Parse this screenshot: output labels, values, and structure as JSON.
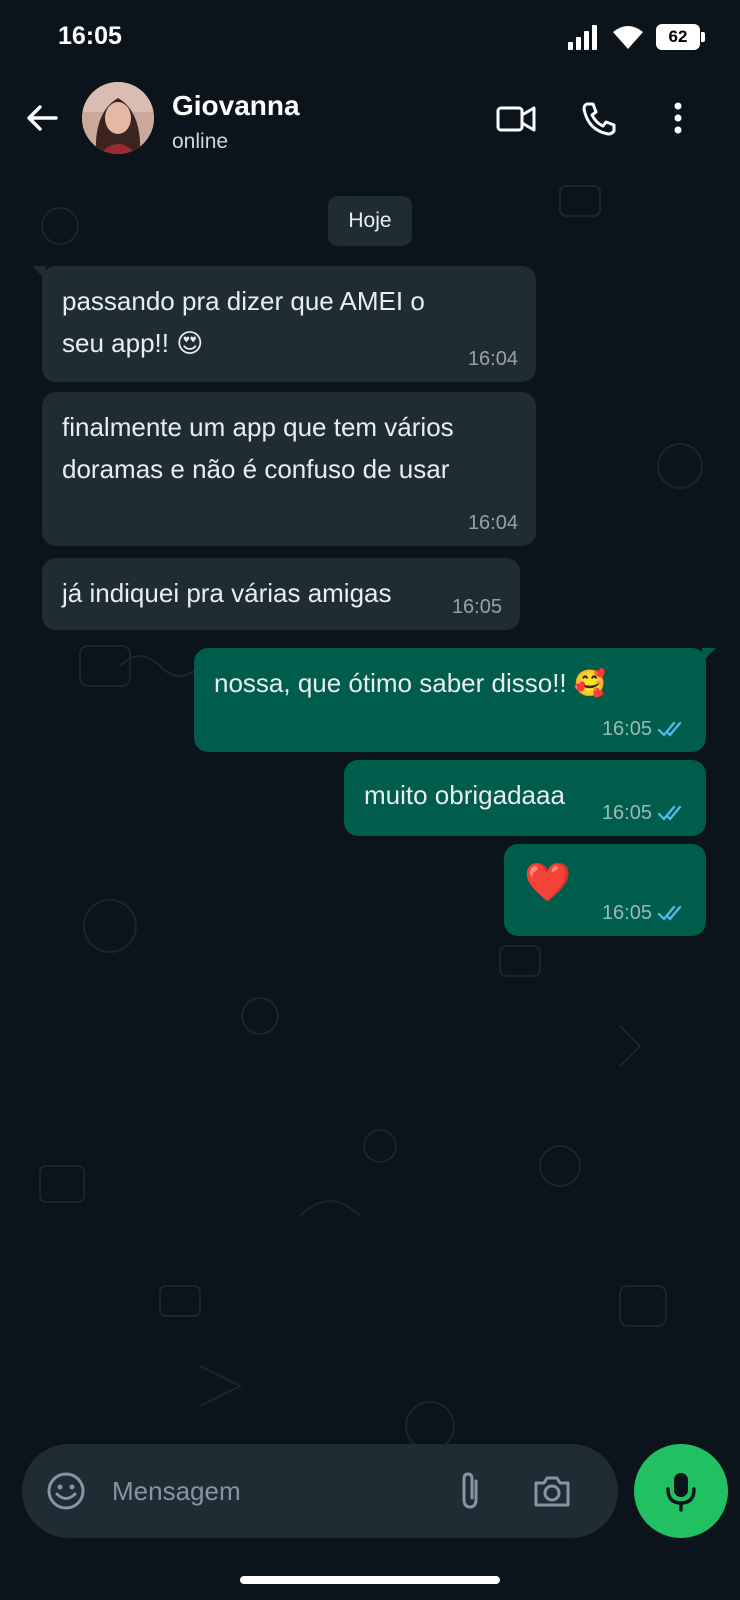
{
  "status_bar": {
    "time": "16:05",
    "battery": "62"
  },
  "header": {
    "contact_name": "Giovanna",
    "contact_status": "online"
  },
  "chat": {
    "date_divider": "Hoje",
    "messages": [
      {
        "direction": "in",
        "text": "passando pra dizer que AMEI o seu app!! 😍",
        "time": "16:04"
      },
      {
        "direction": "in",
        "text": "finalmente um app que tem vários doramas e não é confuso de usar",
        "time": "16:04"
      },
      {
        "direction": "in",
        "text": "já indiquei pra várias amigas",
        "time": "16:05"
      },
      {
        "direction": "out",
        "text": "nossa, que ótimo saber disso!! 🥰",
        "time": "16:05",
        "status": "read"
      },
      {
        "direction": "out",
        "text": "muito obrigadaaa",
        "time": "16:05",
        "status": "read"
      },
      {
        "direction": "out",
        "text": "❤️",
        "time": "16:05",
        "status": "read"
      }
    ]
  },
  "composer": {
    "placeholder": "Mensagem"
  },
  "colors": {
    "background": "#0b141a",
    "incoming_bubble": "#1f2c34",
    "outgoing_bubble": "#005c4b",
    "read_ticks": "#53bdeb",
    "mic_button": "#21c063"
  }
}
